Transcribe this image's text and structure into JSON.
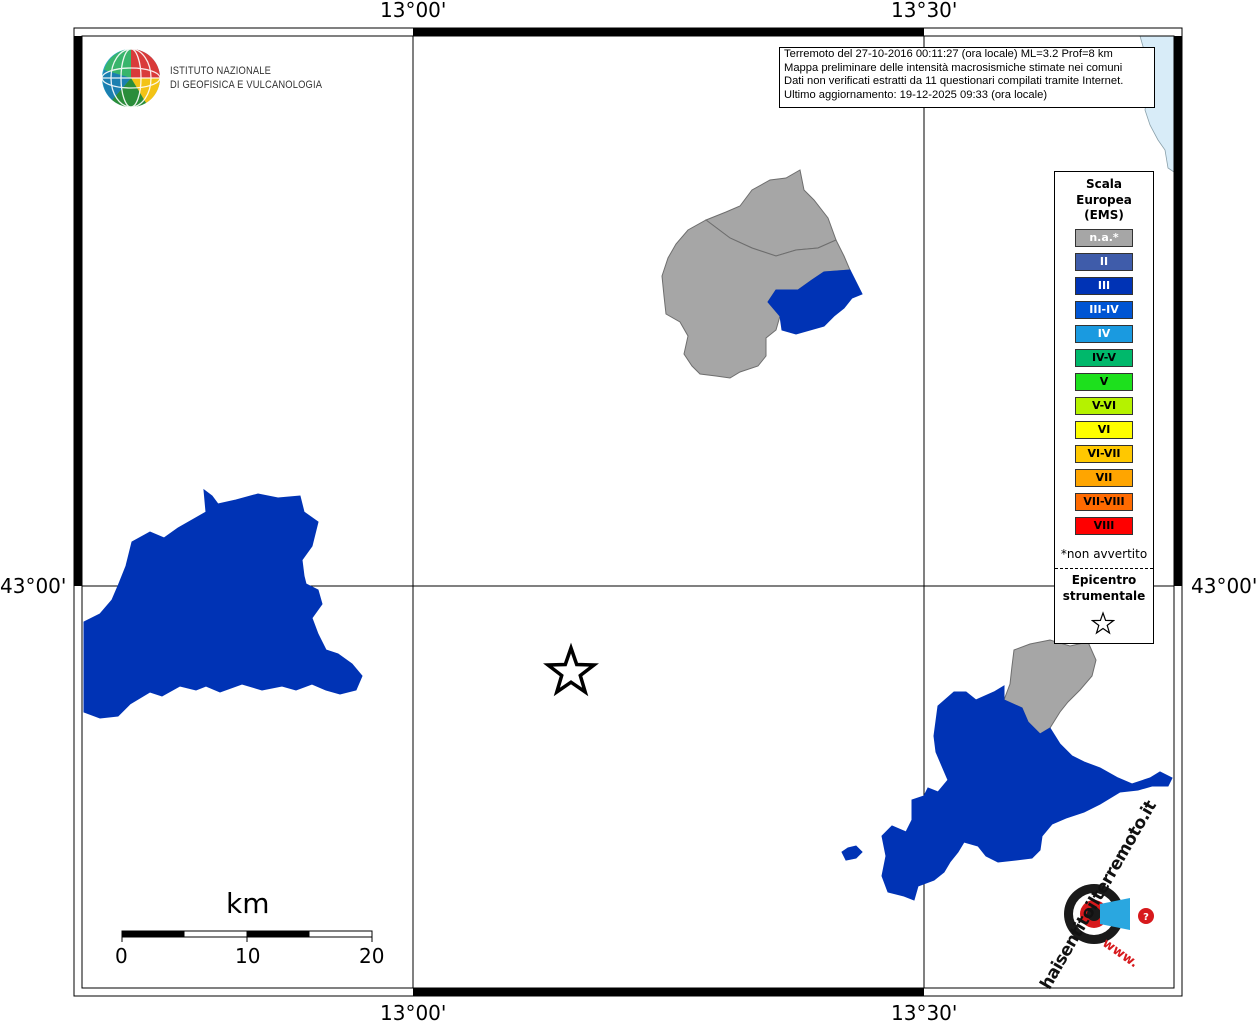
{
  "coords": {
    "top_left": "13°00'",
    "top_right": "13°30'",
    "bottom_left": "13°00'",
    "bottom_right": "13°30'",
    "left_lat": "43°00'",
    "right_lat": "43°00'"
  },
  "logo": {
    "line1": "ISTITUTO NAZIONALE",
    "line2": "DI GEOFISICA E VULCANOLOGIA"
  },
  "info": {
    "line1": "Terremoto del 27-10-2016 00:11:27 (ora locale) ML=3.2 Prof=8 km",
    "line2": "Mappa preliminare delle intensità macrosismiche stimate nei comuni",
    "line3": "Dati non verificati estratti da 11 questionari compilati tramite Internet.",
    "line4": "Ultimo aggiornamento: 19-12-2025 09:33 (ora locale)"
  },
  "legend": {
    "title1": "Scala",
    "title2": "Europea",
    "title3": "(EMS)",
    "items": [
      {
        "label": "n.a.*",
        "color": "#a6a6a6",
        "text_color": "#ffffff"
      },
      {
        "label": "II",
        "color": "#3f5caa",
        "text_color": "#ffffff"
      },
      {
        "label": "III",
        "color": "#0033b5",
        "text_color": "#ffffff"
      },
      {
        "label": "III-IV",
        "color": "#0055d4",
        "text_color": "#ffffff"
      },
      {
        "label": "IV",
        "color": "#1a9ae0",
        "text_color": "#ffffff"
      },
      {
        "label": "IV-V",
        "color": "#00b86b",
        "text_color": "#000000"
      },
      {
        "label": "V",
        "color": "#1de01d",
        "text_color": "#000000"
      },
      {
        "label": "V-VI",
        "color": "#b5f200",
        "text_color": "#000000"
      },
      {
        "label": "VI",
        "color": "#ffff00",
        "text_color": "#000000"
      },
      {
        "label": "VI-VII",
        "color": "#ffc800",
        "text_color": "#000000"
      },
      {
        "label": "VII",
        "color": "#ffa500",
        "text_color": "#000000"
      },
      {
        "label": "VII-VIII",
        "color": "#ff6a00",
        "text_color": "#000000"
      },
      {
        "label": "VIII",
        "color": "#ff0000",
        "text_color": "#000000"
      }
    ],
    "note": "*non avvertito",
    "epicentre1": "Epicentro",
    "epicentre2": "strumentale"
  },
  "scale_bar": {
    "unit": "km",
    "ticks": [
      "0",
      "10",
      "20"
    ]
  },
  "brand": {
    "name": "haisentitoilterremoto.it",
    "web": "www."
  },
  "colors": {
    "intensity_III": "#0033b5",
    "not_felt": "#a6a6a6",
    "sea": "#d8ecf8"
  }
}
